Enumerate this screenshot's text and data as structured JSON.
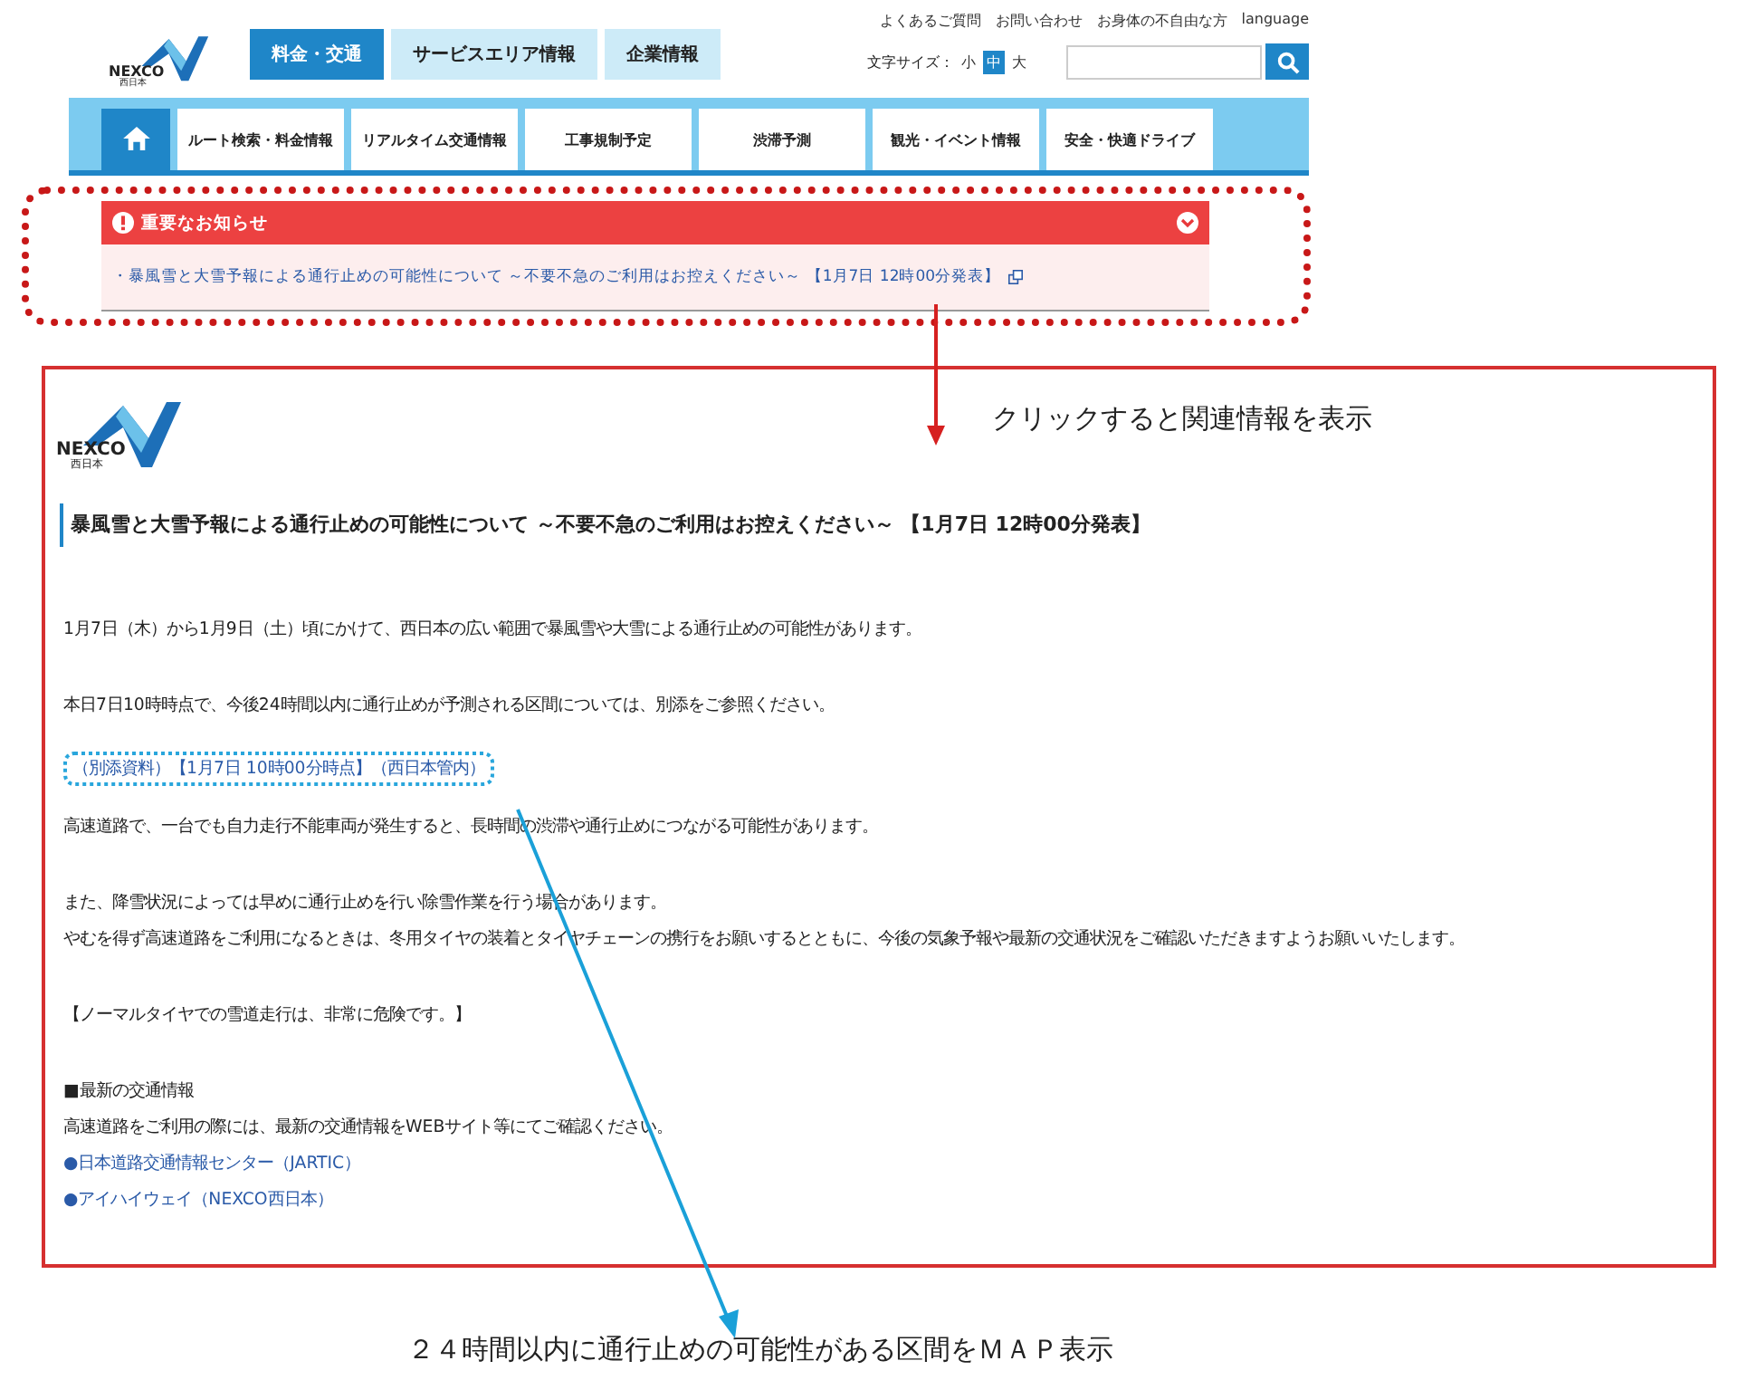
{
  "header": {
    "logo": {
      "name": "NEXCO",
      "region": "西日本"
    },
    "top_tabs": [
      {
        "label": "料金・交通",
        "selected": true
      },
      {
        "label": "サービスエリア情報",
        "selected": false
      },
      {
        "label": "企業情報",
        "selected": false
      }
    ],
    "utility_links": [
      "よくあるご質問",
      "お問い合わせ",
      "お身体の不自由な方",
      "language"
    ],
    "font_size": {
      "label": "文字サイズ：",
      "options": [
        {
          "label": "小",
          "selected": false
        },
        {
          "label": "中",
          "selected": true
        },
        {
          "label": "大",
          "selected": false
        }
      ]
    }
  },
  "nav": {
    "items": [
      {
        "kind": "home",
        "selected": true
      },
      {
        "kind": "text",
        "label": "ルート検索・料金情報",
        "selected": false
      },
      {
        "kind": "text",
        "label": "リアルタイム交通情報",
        "selected": false
      },
      {
        "kind": "text",
        "label": "工事規制予定",
        "selected": false
      },
      {
        "kind": "text",
        "label": "渋滞予測",
        "selected": false
      },
      {
        "kind": "text",
        "label": "観光・イベント情報",
        "selected": false
      },
      {
        "kind": "text",
        "label": "安全・快適ドライブ",
        "selected": false
      }
    ]
  },
  "notice": {
    "title": "重要なお知らせ",
    "expanded": true,
    "items": [
      "・暴風雪と大雪予報による通行止めの可能性について ～不要不急のご利用はお控えください～ 【1月7日 12時00分発表】"
    ]
  },
  "detail": {
    "logo": {
      "name": "NEXCO",
      "region": "西日本"
    },
    "heading": "暴風雪と大雪予報による通行止めの可能性について ～不要不急のご利用はお控えください～ 【1月7日 12時00分発表】",
    "blocks": [
      {
        "kind": "text",
        "text": "1月7日（木）から1月9日（土）頃にかけて、西日本の広い範囲で暴風雪や大雪による通行止めの可能性があります。"
      },
      {
        "kind": "text",
        "text": "本日7日10時時点で、今後24時間以内に通行止めが予測される区間については、別添をご参照ください。"
      },
      {
        "kind": "link",
        "text": "（別添資料）【1月7日 10時00分時点】（西日本管内）"
      },
      {
        "kind": "text",
        "text": "高速道路で、一台でも自力走行不能車両が発生すると、長時間の渋滞や通行止めにつながる可能性があります。"
      },
      {
        "kind": "lines",
        "lines": [
          "また、降雪状況によっては早めに通行止めを行い除雪作業を行う場合があります。",
          "やむを得ず高速道路をご利用になるときは、冬用タイヤの装着とタイヤチェーンの携行をお願いするとともに、今後の気象予報や最新の交通状況をご確認いただきますようお願いいたします。"
        ]
      },
      {
        "kind": "text",
        "text": "【ノーマルタイヤでの雪道走行は、非常に危険です。】"
      },
      {
        "kind": "section",
        "lines": [
          "■最新の交通情報",
          "高速道路をご利用の際には、最新の交通情報をWEBサイト等にてご確認ください。"
        ],
        "links": [
          "●日本道路交通情報センター（JARTIC）",
          "●アイハイウェイ（NEXCO西日本）"
        ]
      }
    ]
  },
  "annotations": [
    {
      "kind": "click",
      "text": "クリックすると関連情報を表示"
    },
    {
      "kind": "map",
      "text": "２４時間以内に通行止めの可能性がある区間をＭＡＰ表示"
    }
  ]
}
